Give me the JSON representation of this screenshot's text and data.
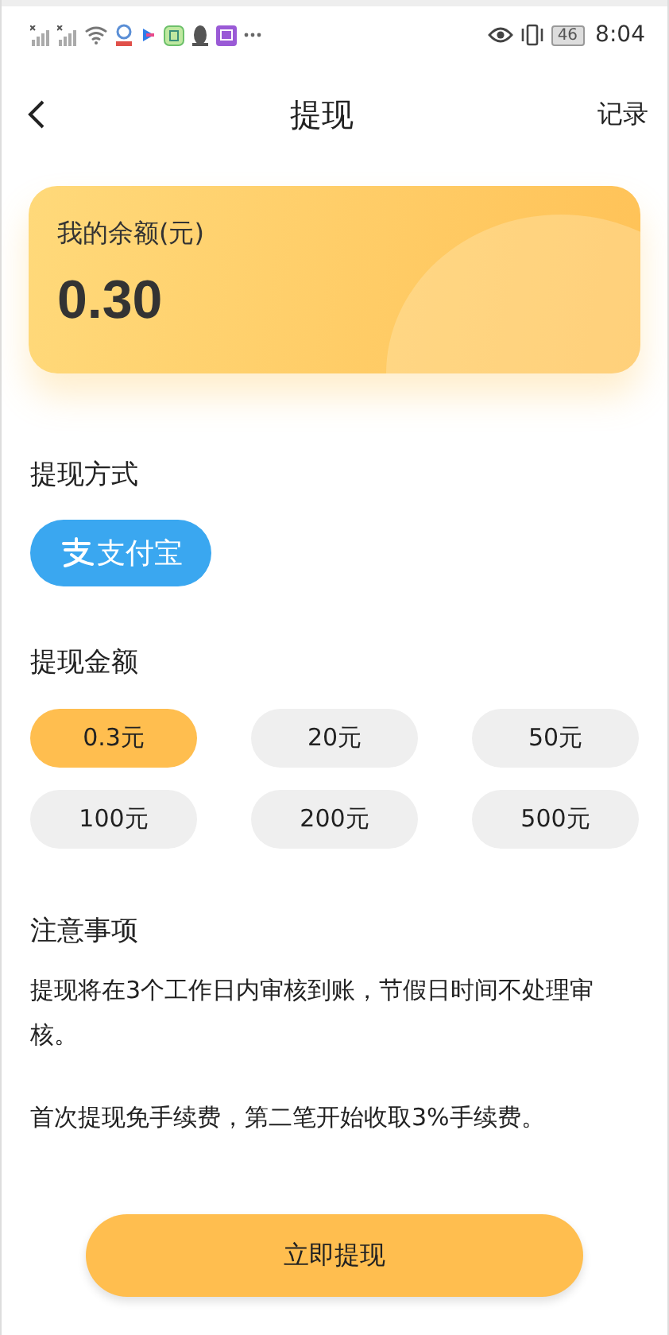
{
  "status_bar": {
    "battery": "46",
    "time": "8:04"
  },
  "header": {
    "title": "提现",
    "action": "记录"
  },
  "balance": {
    "label": "我的余额(元)",
    "amount": "0.30"
  },
  "method": {
    "heading": "提现方式",
    "options": [
      {
        "label": "支付宝",
        "selected": true
      }
    ]
  },
  "amount": {
    "heading": "提现金额",
    "options": [
      {
        "label": "0.3元",
        "selected": true
      },
      {
        "label": "20元",
        "selected": false
      },
      {
        "label": "50元",
        "selected": false
      },
      {
        "label": "100元",
        "selected": false
      },
      {
        "label": "200元",
        "selected": false
      },
      {
        "label": "500元",
        "selected": false
      }
    ]
  },
  "notes": {
    "heading": "注意事项",
    "paragraphs": [
      "提现将在3个工作日内审核到账，节假日时间不处理审核。",
      "首次提现免手续费，第二笔开始收取3%手续费。"
    ]
  },
  "submit": "立即提现"
}
